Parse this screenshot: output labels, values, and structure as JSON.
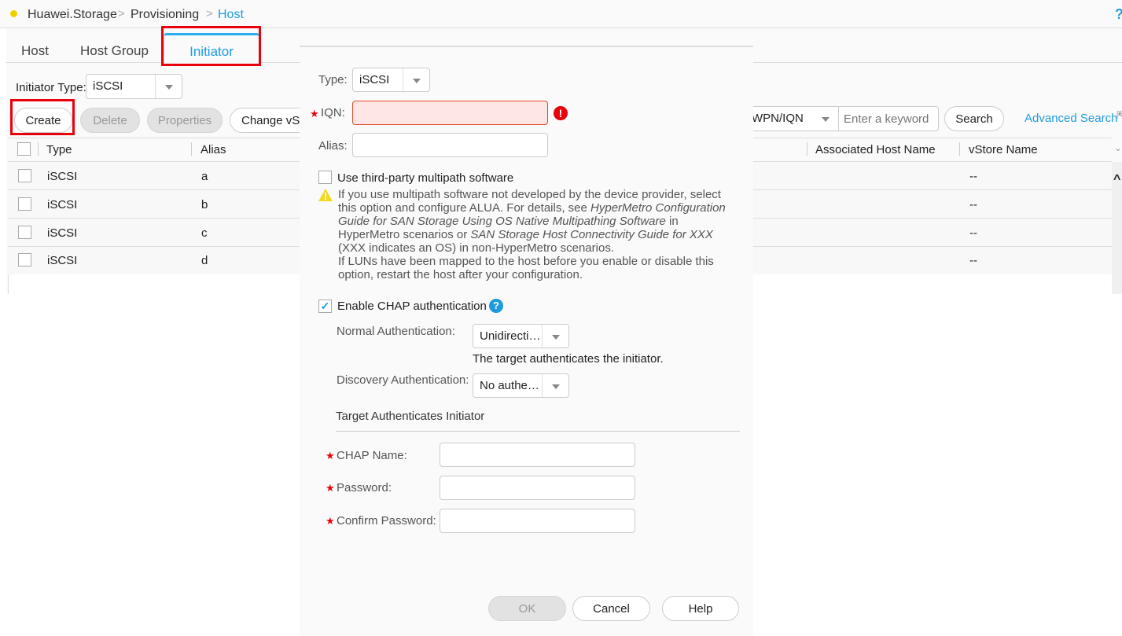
{
  "breadcrumb": {
    "items": [
      "Huawei.Storage",
      "Provisioning",
      "Host"
    ],
    "separator": ">"
  },
  "top_help": "?",
  "tabs": [
    {
      "label": "Host",
      "active": false
    },
    {
      "label": "Host Group",
      "active": false
    },
    {
      "label": "Initiator",
      "active": true
    }
  ],
  "filter": {
    "label": "Initiator Type:",
    "value": "iSCSI"
  },
  "toolbar": {
    "create": "Create",
    "delete": "Delete",
    "properties": "Properties",
    "change_vstore": "Change vS",
    "search_field_value": "WPN/IQN",
    "search_placeholder": "Enter a keyword",
    "search": "Search",
    "advanced_search": "Advanced Search"
  },
  "table": {
    "columns": [
      "Type",
      "Alias",
      "Associated Host Name",
      "vStore Name"
    ],
    "rows": [
      {
        "type": "iSCSI",
        "alias": "a",
        "host": "",
        "vstore": "--"
      },
      {
        "type": "iSCSI",
        "alias": "b",
        "host": "",
        "vstore": "--"
      },
      {
        "type": "iSCSI",
        "alias": "c",
        "host": "",
        "vstore": "--"
      },
      {
        "type": "iSCSI",
        "alias": "d",
        "host": "",
        "vstore": "--"
      }
    ]
  },
  "dialog": {
    "type_label": "Type:",
    "type_value": "iSCSI",
    "iqn_label": "IQN:",
    "iqn_value": "",
    "alias_label": "Alias:",
    "alias_value": "",
    "multipath_label": "Use third-party multipath software",
    "multipath_checked": false,
    "warning": {
      "p1": "If you use multipath software not developed by the device provider, select this option and configure ALUA. For details, see ",
      "doc1": "HyperMetro Configuration Guide for SAN Storage Using OS Native Multipathing Software",
      "p2": " in HyperMetro scenarios or ",
      "doc2": "SAN Storage Host Connectivity Guide for XXX",
      "p3": " (XXX indicates an OS) in non-HyperMetro scenarios.",
      "p4": "If LUNs have been mapped to the host before you enable or disable this option, restart the host after your configuration."
    },
    "chap_label": "Enable CHAP authentication",
    "chap_checked": true,
    "normal_auth_label": "Normal Authentication:",
    "normal_auth_value": "Unidirecti…",
    "normal_auth_hint": "The target authenticates the initiator.",
    "discovery_auth_label": "Discovery Authentication:",
    "discovery_auth_value": "No authe…",
    "section_title": "Target Authenticates Initiator",
    "chap_name_label": "CHAP Name:",
    "password_label": "Password:",
    "confirm_password_label": "Confirm Password:",
    "ok": "OK",
    "cancel": "Cancel",
    "help": "Help"
  }
}
